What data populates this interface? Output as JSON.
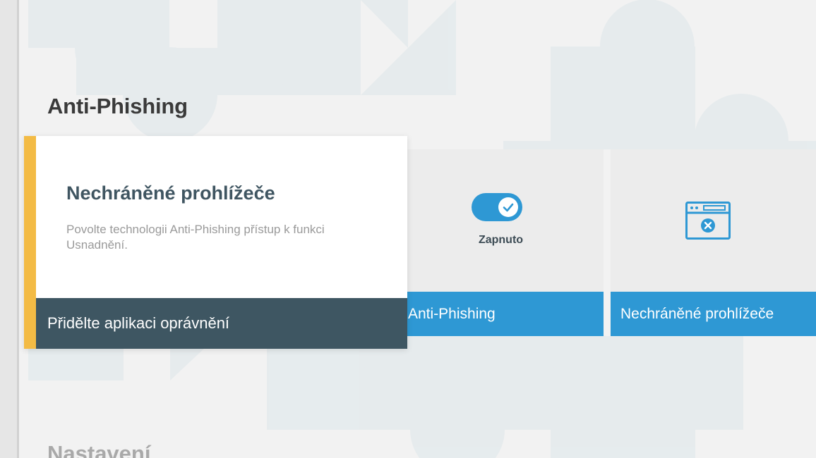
{
  "section": {
    "title": "Anti-Phishing",
    "next_title": "Nastavení"
  },
  "tiles": [
    {
      "label": "Anti-Phishing",
      "status": "Zapnuto",
      "icon": "toggle-on-check-icon",
      "enabled": true
    },
    {
      "label": "Nechráněné prohlížeče",
      "icon": "browser-window-x-icon"
    }
  ],
  "popup": {
    "title": "Nechráněné prohlížeče",
    "description": "Povolte technologii Anti-Phishing přístup k funkci Usnadnění.",
    "action_label": "Přidělte aplikaci oprávnění"
  },
  "colors": {
    "accent_blue": "#2e98d4",
    "popup_accent": "#f3bb45",
    "popup_action_bg": "#3e5662",
    "title_text": "#3f5561"
  }
}
